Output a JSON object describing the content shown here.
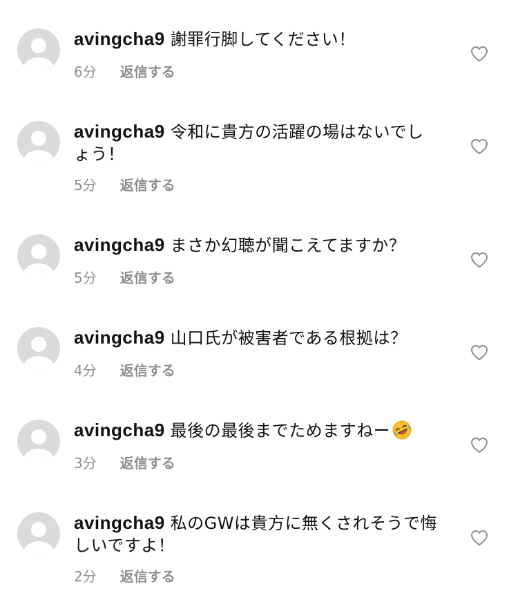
{
  "comments": [
    {
      "username": "avingcha9",
      "text": "謝罪行脚してください！",
      "time": "6分",
      "reply_label": "返信する"
    },
    {
      "username": "avingcha9",
      "text": "令和に貴方の活躍の場はないでしょう！",
      "time": "5分",
      "reply_label": "返信する"
    },
    {
      "username": "avingcha9",
      "text": "まさか幻聴が聞こえてますか？",
      "time": "5分",
      "reply_label": "返信する"
    },
    {
      "username": "avingcha9",
      "text": "山口氏が被害者である根拠は？",
      "time": "4分",
      "reply_label": "返信する"
    },
    {
      "username": "avingcha9",
      "text": "最後の最後までためますねー",
      "emoji": "rolling-on-the-floor-laughing-emoji",
      "time": "3分",
      "reply_label": "返信する"
    },
    {
      "username": "avingcha9",
      "text": "私のGWは貴方に無くされそうで悔しいですよ！",
      "time": "2分",
      "reply_label": "返信する"
    }
  ],
  "icons": {
    "avatar": "default-avatar-icon",
    "like": "heart-outline-icon"
  },
  "colors": {
    "text": "#111111",
    "meta": "#8e8e8e",
    "avatar_bg": "#dbdbdb",
    "heart_stroke": "#8e8e8e"
  }
}
